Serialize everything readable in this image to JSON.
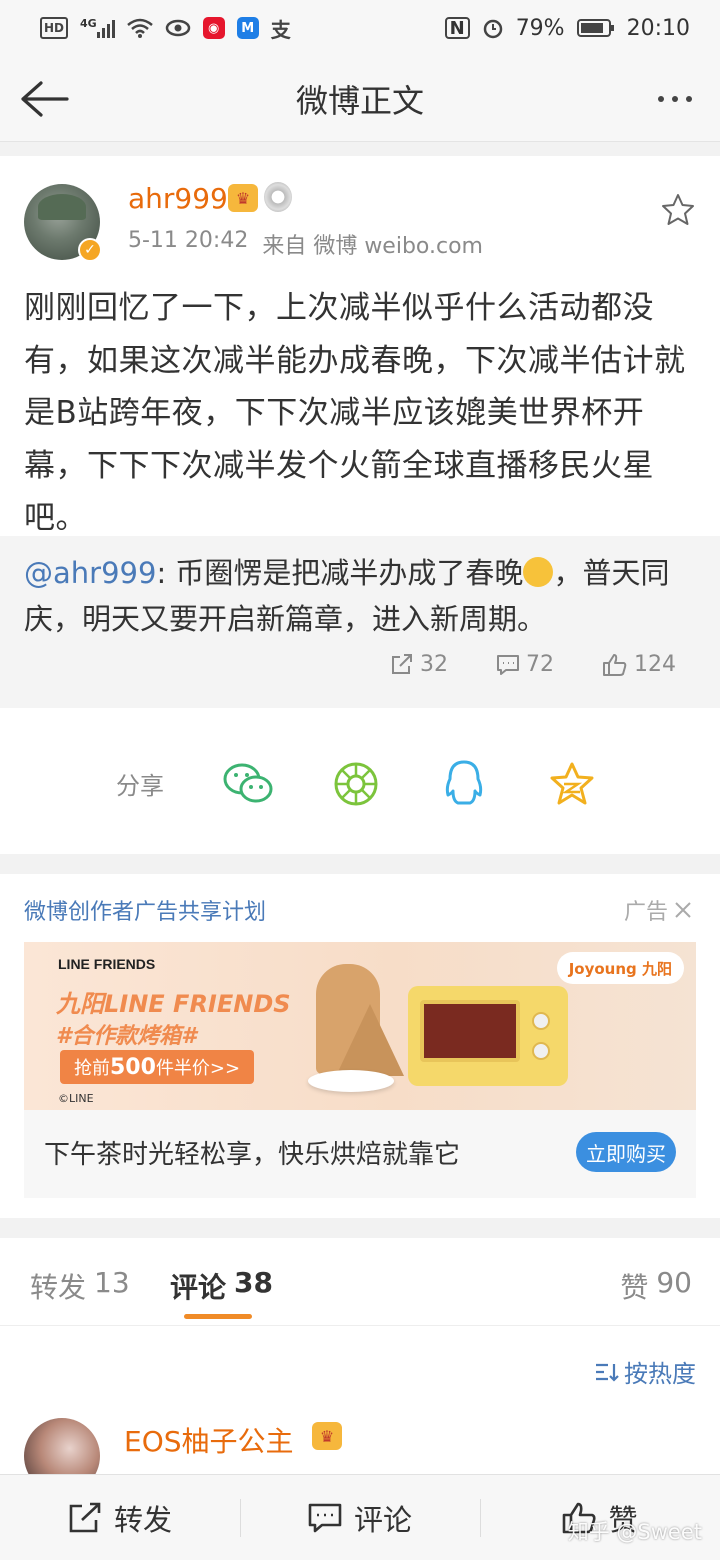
{
  "status_bar": {
    "hd": "HD",
    "signal": "4G",
    "nfc": "N",
    "battery": "79%",
    "time": "20:10"
  },
  "nav": {
    "title": "微博正文"
  },
  "post": {
    "user_name": "ahr999",
    "time": "5-11 20:42",
    "source": "来自 微博 weibo.com",
    "text": "刚刚回忆了一下，上次减半似乎什么活动都没有，如果这次减半能办成春晚，下次减半估计就是B站跨年夜，下下次减半应该媲美世界杯开幕，下下下次减半发个火箭全球直播移民火星吧。",
    "repost": {
      "user": "@ahr999",
      "text_before_emoji": ": 币圈愣是把减半办成了春晚",
      "text_after_emoji": "，普天同庆，明天又要开启新篇章，进入新周期。"
    },
    "stats": {
      "reposts": "32",
      "comments": "72",
      "likes": "124"
    }
  },
  "share": {
    "label": "分享",
    "targets": [
      "wechat-icon",
      "moments-icon",
      "qq-icon",
      "qzone-icon"
    ]
  },
  "ad": {
    "header": "微博创作者广告共享计划",
    "tag": "广告",
    "banner": {
      "brand": "LINE FRIENDS",
      "title": "九阳LINE FRIENDS",
      "subtitle": "#合作款烤箱#",
      "cta_prefix": "抢前",
      "cta_number": "500",
      "cta_suffix": "件半价>>",
      "copyright": "©LINE",
      "partner": "Joyoung 九阳"
    },
    "caption": "下午茶时光轻松享，快乐烘焙就靠它",
    "buy": "立即购买"
  },
  "tabs": {
    "repost_label": "转发",
    "repost_count": "13",
    "comment_label": "评论",
    "comment_count": "38",
    "like_label": "赞",
    "like_count": "90"
  },
  "comments": {
    "sort": "按热度",
    "first_user": "EOS柚子公主"
  },
  "toolbar": {
    "repost": "转发",
    "comment": "评论",
    "like": "赞"
  },
  "watermark": "知乎 @Sweet",
  "colors": {
    "username": "#e86b0c",
    "link": "#4a7ab8",
    "accent": "#f08b27",
    "buy_button": "#3b8fe0"
  }
}
